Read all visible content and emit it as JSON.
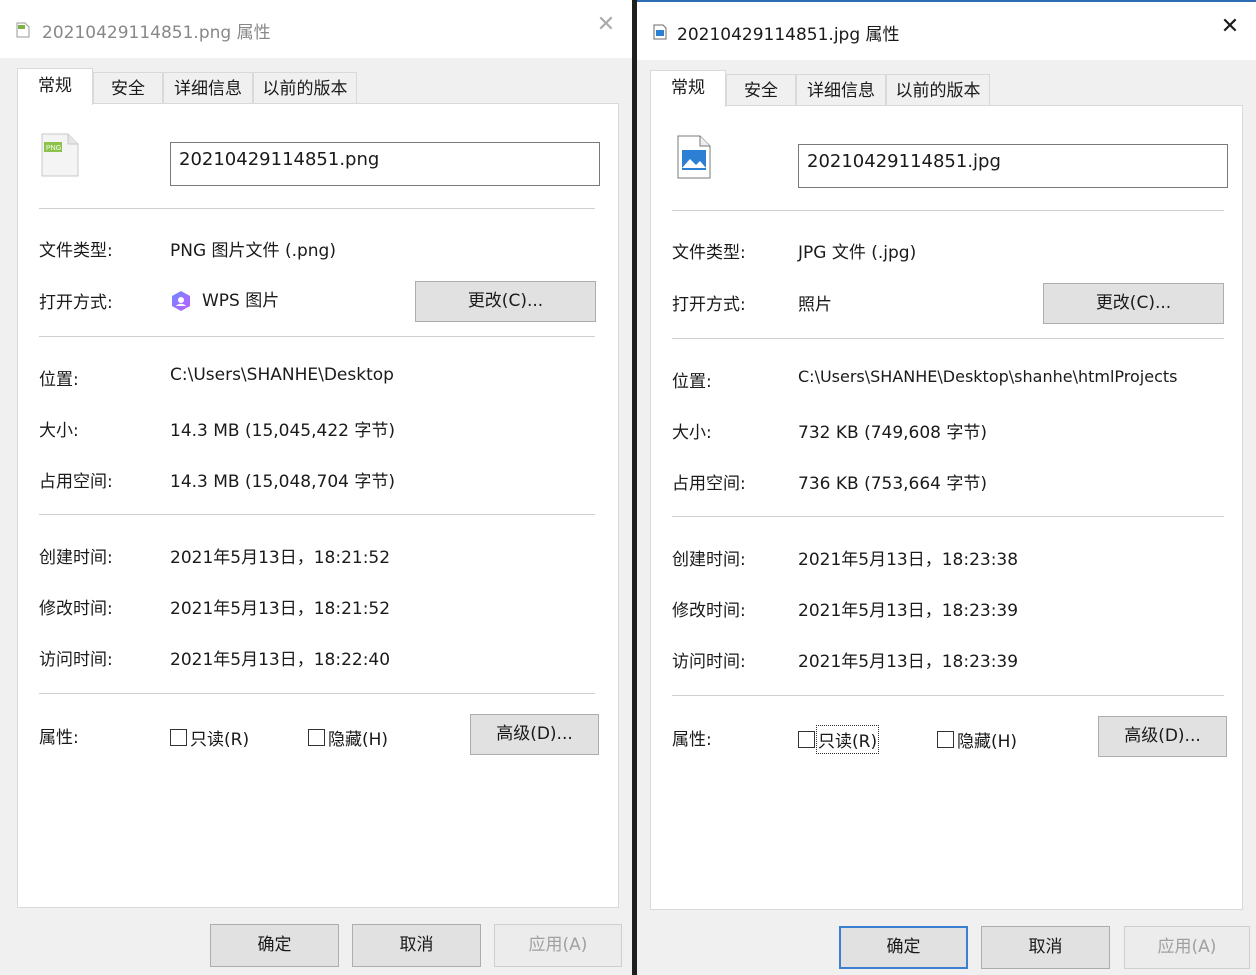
{
  "left": {
    "title": "20210429114851.png 属性",
    "close": "✕",
    "tabs": [
      "常规",
      "安全",
      "详细信息",
      "以前的版本"
    ],
    "filename": "20210429114851.png",
    "file_icon": "png-file-icon",
    "rows": {
      "type_label": "文件类型:",
      "type_value": "PNG 图片文件 (.png)",
      "open_label": "打开方式:",
      "open_value": "WPS 图片",
      "open_app_icon": "wps-photo-icon",
      "change_button": "更改(C)...",
      "location_label": "位置:",
      "location_value": "C:\\Users\\SHANHE\\Desktop",
      "size_label": "大小:",
      "size_value": "14.3 MB (15,045,422 字节)",
      "disk_label": "占用空间:",
      "disk_value": "14.3 MB (15,048,704 字节)",
      "created_label": "创建时间:",
      "created_value": "2021年5月13日，18:21:52",
      "modified_label": "修改时间:",
      "modified_value": "2021年5月13日，18:21:52",
      "accessed_label": "访问时间:",
      "accessed_value": "2021年5月13日，18:22:40",
      "attr_label": "属性:",
      "readonly": "只读(R)",
      "hidden": "隐藏(H)",
      "advanced_button": "高级(D)..."
    },
    "footer": {
      "ok": "确定",
      "cancel": "取消",
      "apply": "应用(A)"
    }
  },
  "right": {
    "title": "20210429114851.jpg 属性",
    "close": "✕",
    "tabs": [
      "常规",
      "安全",
      "详细信息",
      "以前的版本"
    ],
    "filename": "20210429114851.jpg",
    "file_icon": "jpg-photo-file-icon",
    "rows": {
      "type_label": "文件类型:",
      "type_value": "JPG 文件 (.jpg)",
      "open_label": "打开方式:",
      "open_value": "照片",
      "change_button": "更改(C)...",
      "location_label": "位置:",
      "location_value": "C:\\Users\\SHANHE\\Desktop\\shanhe\\htmlProjects",
      "size_label": "大小:",
      "size_value": "732 KB (749,608 字节)",
      "disk_label": "占用空间:",
      "disk_value": "736 KB (753,664 字节)",
      "created_label": "创建时间:",
      "created_value": "2021年5月13日，18:23:38",
      "modified_label": "修改时间:",
      "modified_value": "2021年5月13日，18:23:39",
      "accessed_label": "访问时间:",
      "accessed_value": "2021年5月13日，18:23:39",
      "attr_label": "属性:",
      "readonly": "只读(R)",
      "hidden": "隐藏(H)",
      "advanced_button": "高级(D)..."
    },
    "footer": {
      "ok": "确定",
      "cancel": "取消",
      "apply": "应用(A)"
    }
  },
  "colors": {
    "window_bg": "#f0f0f0",
    "panel_bg": "#ffffff",
    "accent_blue": "#3b7fd1"
  }
}
